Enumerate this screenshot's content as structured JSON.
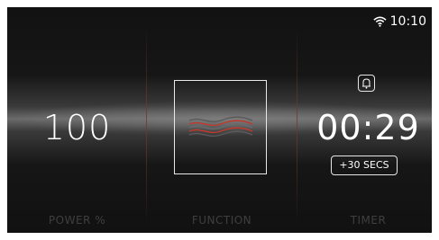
{
  "status": {
    "time": "10:10",
    "wifi_icon": "wifi-icon"
  },
  "power": {
    "value": "100",
    "label": "POWER %"
  },
  "function": {
    "label": "FUNCTION",
    "icon": "microwave-waves-icon"
  },
  "timer": {
    "value": "00:29",
    "label": "TIMER",
    "add_button": "+30 SECS",
    "icon": "bell-icon"
  },
  "colors": {
    "background": "#121212",
    "divider": "#6e3729",
    "wave_accent": "#c0392b",
    "label": "#3f3f3f"
  }
}
